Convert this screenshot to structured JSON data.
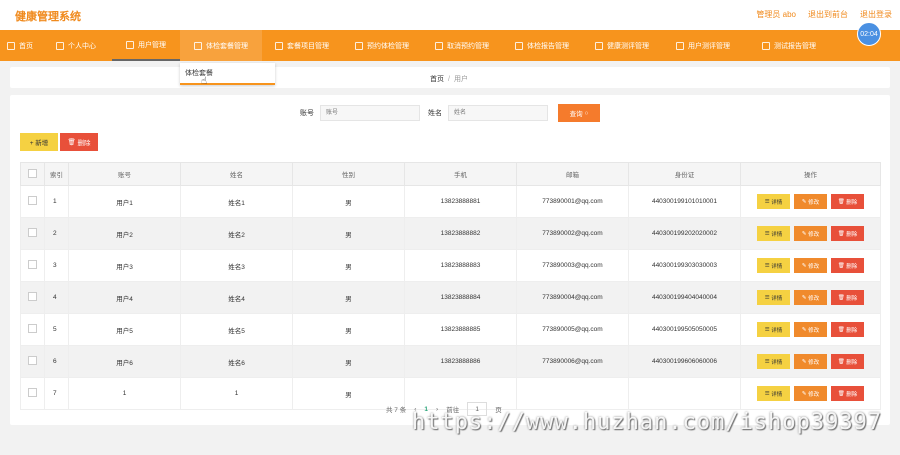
{
  "app": {
    "title": "健康管理系统"
  },
  "top_links": [
    "管理员 abo",
    "退出到前台",
    "退出登录"
  ],
  "nav": [
    {
      "label": "首页"
    },
    {
      "label": "个人中心"
    },
    {
      "label": "用户管理"
    },
    {
      "label": "体检套餐管理"
    },
    {
      "label": "套餐项目管理"
    },
    {
      "label": "预约体检管理"
    },
    {
      "label": "取消预约管理"
    },
    {
      "label": "体检报告管理"
    },
    {
      "label": "健康测评管理"
    },
    {
      "label": "用户测评管理"
    },
    {
      "label": "测试报告管理"
    }
  ],
  "badge": "02:04",
  "dropdown": {
    "item": "体检套餐"
  },
  "breadcrumb": {
    "home": "首页",
    "sep": "/",
    "current": "用户"
  },
  "search": {
    "account_label": "账号",
    "account_placeholder": "账号",
    "name_label": "姓名",
    "name_placeholder": "姓名",
    "button": "查询"
  },
  "actions": {
    "add": "+ 新增",
    "delete": "删除"
  },
  "table": {
    "headers": [
      "",
      "索引",
      "账号",
      "姓名",
      "性别",
      "手机",
      "邮箱",
      "身份证",
      "操作"
    ],
    "rows": [
      {
        "idx": "1",
        "account": "用户1",
        "name": "姓名1",
        "gender": "男",
        "phone": "13823888881",
        "email": "773890001@qq.com",
        "id": "440300199101010001"
      },
      {
        "idx": "2",
        "account": "用户2",
        "name": "姓名2",
        "gender": "男",
        "phone": "13823888882",
        "email": "773890002@qq.com",
        "id": "440300199202020002"
      },
      {
        "idx": "3",
        "account": "用户3",
        "name": "姓名3",
        "gender": "男",
        "phone": "13823888883",
        "email": "773890003@qq.com",
        "id": "440300199303030003"
      },
      {
        "idx": "4",
        "account": "用户4",
        "name": "姓名4",
        "gender": "男",
        "phone": "13823888884",
        "email": "773890004@qq.com",
        "id": "440300199404040004"
      },
      {
        "idx": "5",
        "account": "用户5",
        "name": "姓名5",
        "gender": "男",
        "phone": "13823888885",
        "email": "773890005@qq.com",
        "id": "440300199505050005"
      },
      {
        "idx": "6",
        "account": "用户6",
        "name": "姓名6",
        "gender": "男",
        "phone": "13823888886",
        "email": "773890006@qq.com",
        "id": "440300199606060006"
      },
      {
        "idx": "7",
        "account": "1",
        "name": "1",
        "gender": "男",
        "phone": "",
        "email": "",
        "id": ""
      }
    ],
    "ops": {
      "detail": "详情",
      "edit": "修改",
      "remove": "删除"
    }
  },
  "pager": {
    "total": "共 7 条",
    "prev": "‹",
    "page": "1",
    "next": "›",
    "goto": "前往",
    "goto_value": "1",
    "unit": "页"
  },
  "watermark": "https://www.huzhan.com/ishop39397"
}
